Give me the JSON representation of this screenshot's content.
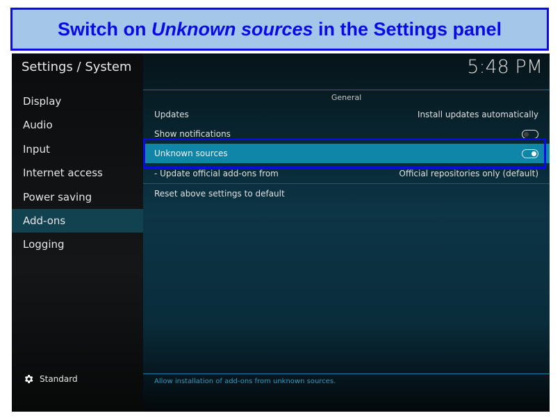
{
  "banner": {
    "prefix": "Switch on ",
    "emphasis": "Unknown sources",
    "suffix": " in the Settings panel"
  },
  "header": {
    "title": "Settings / System",
    "clock": "5:48 PM"
  },
  "sidebar": {
    "items": [
      {
        "label": "Display"
      },
      {
        "label": "Audio"
      },
      {
        "label": "Input"
      },
      {
        "label": "Internet access"
      },
      {
        "label": "Power saving"
      },
      {
        "label": "Add-ons",
        "selected": true
      },
      {
        "label": "Logging"
      }
    ],
    "level": {
      "icon": "gear-icon",
      "label": "Standard"
    }
  },
  "main": {
    "group": "General",
    "rows": [
      {
        "label": "Updates",
        "value": "Install updates automatically"
      },
      {
        "label": "Show notifications",
        "toggle": false
      },
      {
        "label": "Unknown sources",
        "toggle": true,
        "focused": true
      },
      {
        "label": "- Update official add-ons from",
        "value": "Official repositories only (default)"
      },
      {
        "label": "Reset above settings to default"
      }
    ],
    "help": "Allow installation of add-ons from unknown sources."
  },
  "colors": {
    "highlight": "#0a0ae6",
    "focus_row": "#0f86a8",
    "banner_bg": "#a4c6e9"
  }
}
